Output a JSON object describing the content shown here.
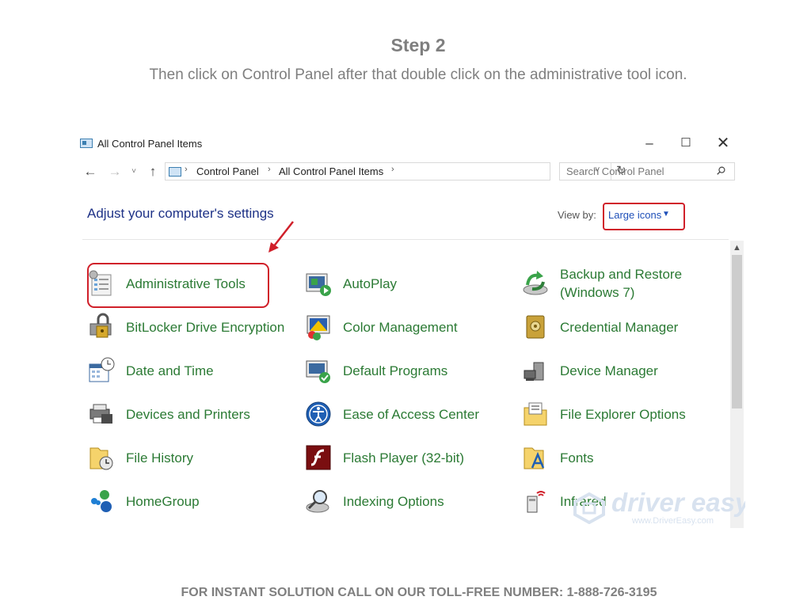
{
  "slide": {
    "heading": "Step 2",
    "instructions": "Then click on Control Panel  after that double click on the administrative tool icon.",
    "footer": "FOR INSTANT SOLUTION CALL ON OUR TOLL-FREE NUMBER: 1-888-726-3195"
  },
  "window": {
    "title": "All Control Panel Items",
    "controls": {
      "minimize": "–",
      "maximize": "☐",
      "close": "✕"
    },
    "nav": {
      "back": "←",
      "forward": "→",
      "recent": "˅",
      "up": "↑",
      "dropdown": "˅",
      "refresh": "↻"
    },
    "breadcrumb": {
      "sep": "›",
      "items": [
        "Control Panel",
        "All Control Panel Items"
      ]
    },
    "search": {
      "placeholder": "Search Control Panel"
    },
    "settings_title": "Adjust your computer's settings",
    "view_by": {
      "label": "View by:",
      "value": "Large icons",
      "caret": "▼"
    },
    "scroll_up": "▲",
    "accent_color": "#d0202a",
    "link_color": "#2b7a34",
    "items": [
      {
        "label": "Administrative Tools",
        "icon": "administrative-tools-icon"
      },
      {
        "label": "AutoPlay",
        "icon": "autoplay-icon"
      },
      {
        "label": "Backup and Restore (Windows 7)",
        "icon": "backup-restore-icon"
      },
      {
        "label": "BitLocker Drive Encryption",
        "icon": "bitlocker-icon"
      },
      {
        "label": "Color Management",
        "icon": "color-management-icon"
      },
      {
        "label": "Credential Manager",
        "icon": "credential-manager-icon"
      },
      {
        "label": "Date and Time",
        "icon": "date-time-icon"
      },
      {
        "label": "Default Programs",
        "icon": "default-programs-icon"
      },
      {
        "label": "Device Manager",
        "icon": "device-manager-icon"
      },
      {
        "label": "Devices and Printers",
        "icon": "devices-printers-icon"
      },
      {
        "label": "Ease of Access Center",
        "icon": "ease-of-access-icon"
      },
      {
        "label": "File Explorer Options",
        "icon": "file-explorer-options-icon"
      },
      {
        "label": "File History",
        "icon": "file-history-icon"
      },
      {
        "label": "Flash Player (32-bit)",
        "icon": "flash-player-icon"
      },
      {
        "label": "Fonts",
        "icon": "fonts-icon"
      },
      {
        "label": "HomeGroup",
        "icon": "homegroup-icon"
      },
      {
        "label": "Indexing Options",
        "icon": "indexing-options-icon"
      },
      {
        "label": "Infrared",
        "icon": "infrared-icon"
      }
    ],
    "watermark": {
      "brand": "driver easy",
      "site": "www.DriverEasy.com"
    }
  }
}
